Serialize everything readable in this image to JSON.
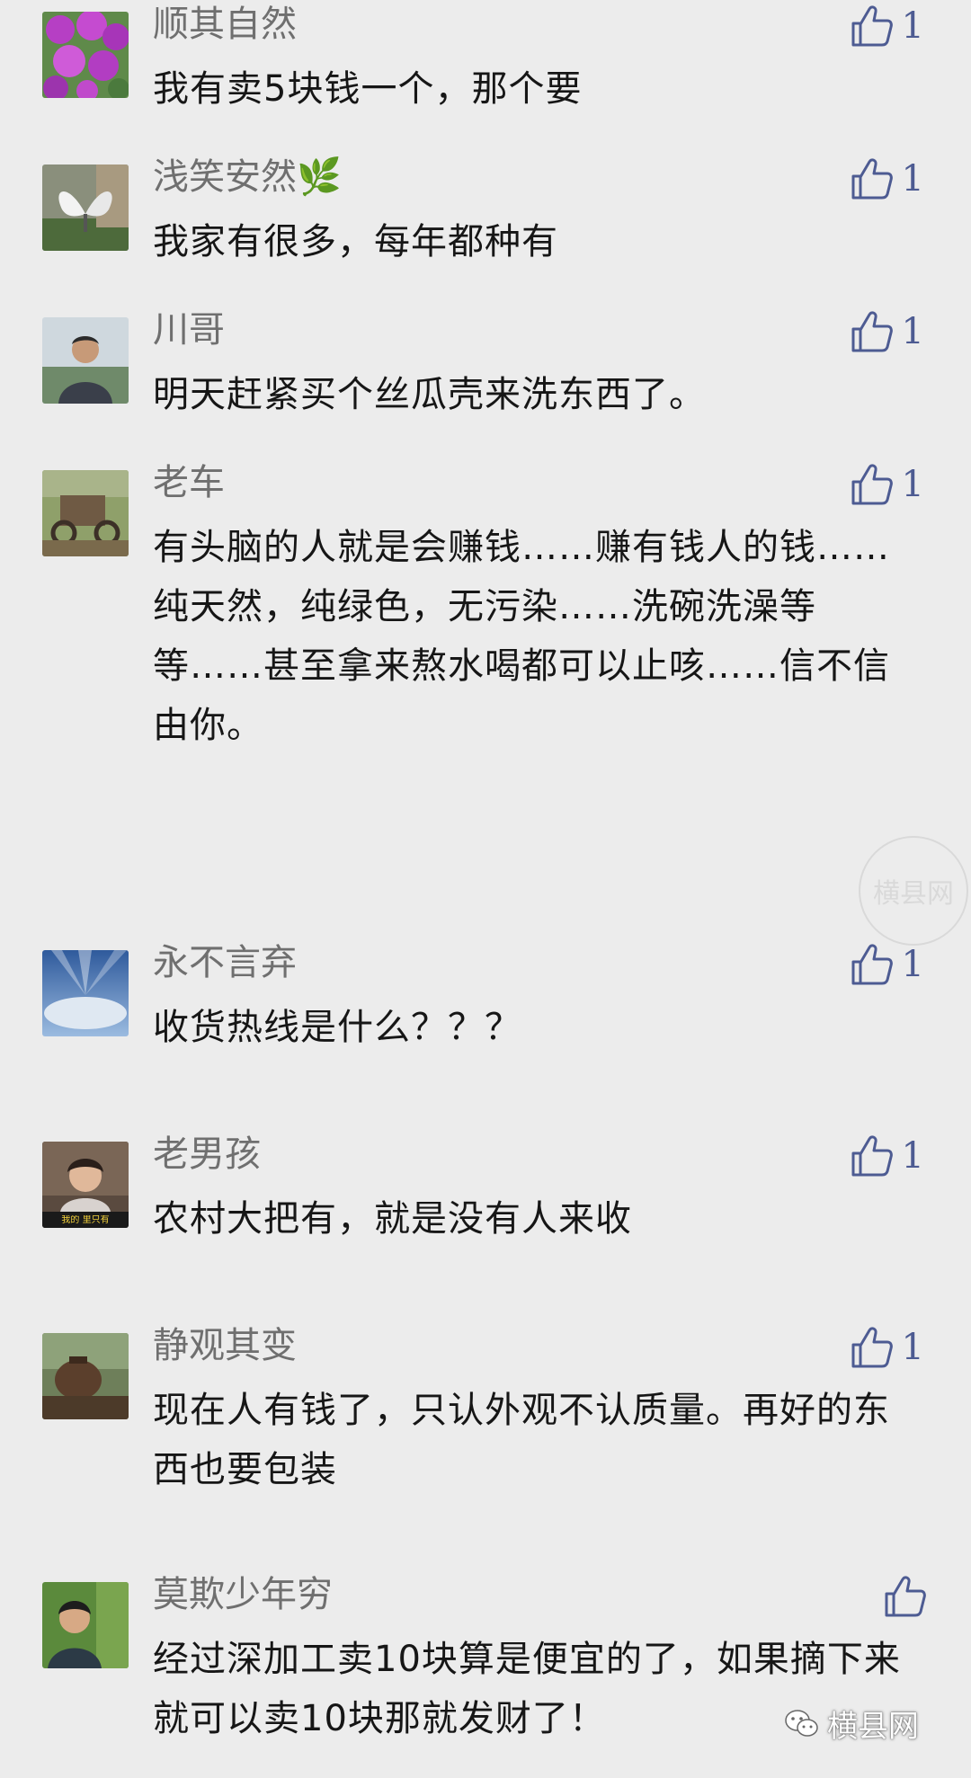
{
  "comments": [
    {
      "name": "顺其自然",
      "text": "我有卖5块钱一个，那个要",
      "likes": "1",
      "avatar_icon": "purple-flowers-avatar"
    },
    {
      "name": "浅笑安然🌿",
      "text": "我家有很多，每年都种有",
      "likes": "1",
      "avatar_icon": "white-butterfly-avatar"
    },
    {
      "name": "川哥",
      "text": "明天赶紧买个丝瓜壳来洗东西了。",
      "likes": "1",
      "avatar_icon": "man-portrait-avatar"
    },
    {
      "name": "老车",
      "text": "有头脑的人就是会赚钱……赚有钱人的钱……纯天然，纯绿色，无污染……洗碗洗澡等等……甚至拿来熬水喝都可以止咳……信不信由你。",
      "likes": "1",
      "avatar_icon": "old-cart-avatar"
    },
    {
      "name": "永不言弃",
      "text": "收货热线是什么？？？",
      "likes": "1",
      "avatar_icon": "sky-rays-avatar"
    },
    {
      "name": "老男孩",
      "text": "农村大把有，就是没有人来收",
      "likes": "1",
      "avatar_icon": "person-video-avatar"
    },
    {
      "name": "静观其变",
      "text": "现在人有钱了，只认外观不认质量。再好的东西也要包装",
      "likes": "1",
      "avatar_icon": "clay-pot-avatar"
    },
    {
      "name": "莫欺少年穷",
      "text": "经过深加工卖10块算是便宜的了，如果摘下来就可以卖10块那就发财了！",
      "likes": "",
      "avatar_icon": "young-man-avatar"
    }
  ],
  "avatar_captions": {
    "person_video": "我的 里只有"
  },
  "watermark": "横县网",
  "brand": {
    "label": "横县网",
    "icon": "wechat-logo-icon"
  },
  "colors": {
    "background": "#ececec",
    "name": "#6f6f6f",
    "text": "#161616",
    "like": "#4d5b92"
  }
}
